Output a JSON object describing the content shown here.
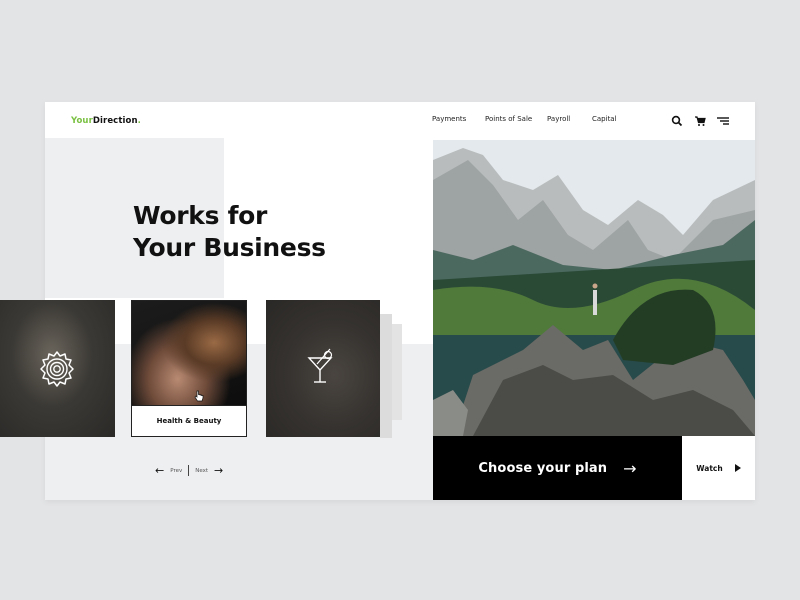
{
  "header": {
    "logo_primary": "Your",
    "logo_secondary": "Direction",
    "logo_dot": ".",
    "nav": [
      "Payments",
      "Points of Sale",
      "Payroll",
      "Capital"
    ],
    "icons": [
      "search-icon",
      "cart-icon",
      "menu-icon"
    ]
  },
  "hero": {
    "headline_line1": "Works for",
    "headline_line2": "Your Business"
  },
  "cards": [
    {
      "name": "settings",
      "icon": "gear-icon",
      "label": ""
    },
    {
      "name": "health-beauty",
      "icon": "",
      "label": "Health & Beauty"
    },
    {
      "name": "food-drink",
      "icon": "cocktail-icon",
      "label": ""
    }
  ],
  "pager": {
    "prev_label": "Prev",
    "next_label": "Next",
    "prev_arrow": "←",
    "next_arrow": "→"
  },
  "cta": {
    "label": "Choose your plan",
    "arrow": "→"
  },
  "watch": {
    "label": "Watch"
  },
  "colors": {
    "accent": "#7ac142",
    "cta_bg": "#000000",
    "panel_grey": "#eeeff1",
    "background": "#e3e4e6"
  }
}
